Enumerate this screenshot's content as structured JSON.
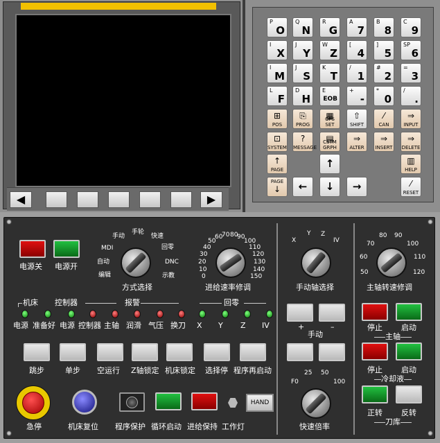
{
  "keypad": {
    "keys": [
      {
        "sub": "P",
        "main": "O"
      },
      {
        "sub": "Q",
        "main": "N"
      },
      {
        "sub": "R",
        "main": "G"
      },
      {
        "sub": "A",
        "main": "7"
      },
      {
        "sub": "B",
        "main": "8"
      },
      {
        "sub": "C",
        "main": "9"
      },
      {
        "sub": "I",
        "main": "X"
      },
      {
        "sub": "J",
        "main": "Y"
      },
      {
        "sub": "W",
        "main": "Z"
      },
      {
        "sub": "[",
        "main": "4"
      },
      {
        "sub": "]",
        "main": "5"
      },
      {
        "sub": "SP",
        "main": "6"
      },
      {
        "sub": "I",
        "main": "M"
      },
      {
        "sub": "J",
        "main": "S"
      },
      {
        "sub": "K",
        "main": "T"
      },
      {
        "sub": "/",
        "main": "1"
      },
      {
        "sub": "#",
        "main": "2"
      },
      {
        "sub": "=",
        "main": "3"
      },
      {
        "sub": "L",
        "main": "F"
      },
      {
        "sub": "D",
        "main": "H"
      },
      {
        "sub": "E",
        "main": "EOB"
      },
      {
        "sub": "+",
        "main": "-"
      },
      {
        "sub": "*",
        "main": "0"
      },
      {
        "sub": "/",
        "main": "."
      }
    ],
    "func_row1": [
      "POS",
      "PROG",
      "OFS SET",
      "SHIFT",
      "CAN",
      "INPUT"
    ],
    "func_row2": [
      "SYSTEM",
      "MESSAGE",
      "CSTM GRPH",
      "ALTER",
      "INSERT",
      "DELETE"
    ],
    "page_up": "PAGE",
    "page_down": "PAGE",
    "help": "HELP",
    "reset": "RESET"
  },
  "power": {
    "off": "电源关",
    "on": "电源开"
  },
  "mode": {
    "title": "方式选择",
    "options": [
      "编辑",
      "自动",
      "MDI",
      "手动",
      "手轮",
      "快速",
      "回零",
      "DNC",
      "示教"
    ]
  },
  "feed": {
    "title": "进给速率修调",
    "ticks": [
      "0",
      "10",
      "20",
      "30",
      "40",
      "50",
      "60",
      "70",
      "80",
      "90",
      "100",
      "110",
      "120",
      "130",
      "140",
      "150"
    ]
  },
  "axis_sel": {
    "title": "手动轴选择",
    "ticks": [
      "X",
      "Y",
      "Z",
      "IV"
    ]
  },
  "spindle_ovr": {
    "title": "主轴转速修调",
    "ticks": [
      "50",
      "60",
      "70",
      "80",
      "90",
      "100",
      "110",
      "120"
    ]
  },
  "status": {
    "group_machine": "机床",
    "group_ctrl": "控制器",
    "group_alarm": "报警",
    "group_home": "回零",
    "leds": [
      "电源",
      "准备好",
      "电源",
      "控制器",
      "主轴",
      "润滑",
      "气压",
      "换刀",
      "X",
      "Y",
      "Z",
      "IV"
    ]
  },
  "jog": {
    "plus": "+",
    "minus": "–",
    "label": "手动"
  },
  "rapid": {
    "title": "快速倍率",
    "ticks": [
      "F0",
      "25",
      "50",
      "100"
    ]
  },
  "spindle": {
    "stop": "停止",
    "start": "启动",
    "group": "主轴"
  },
  "coolant": {
    "stop": "停止",
    "start": "启动",
    "group": "冷却液"
  },
  "magazine": {
    "fwd": "正转",
    "rev": "反转",
    "group": "刀库"
  },
  "functions": [
    "跳步",
    "单步",
    "空运行",
    "Z轴锁定",
    "机床锁定",
    "选择停",
    "程序再启动"
  ],
  "bottom": {
    "estop": "急停",
    "reset": "机床复位",
    "prog_protect": "程序保护",
    "cycle_start": "循环启动",
    "feed_hold": "进给保持",
    "work_light": "工作灯",
    "hand": "HAND"
  }
}
